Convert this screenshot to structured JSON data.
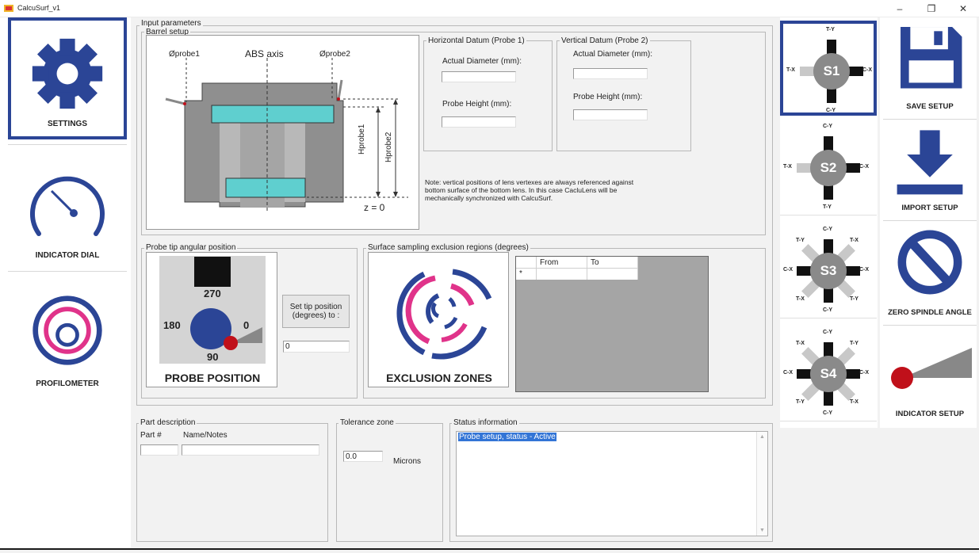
{
  "window": {
    "title": "CalcuSurf_v1",
    "minimize": "–",
    "maximize": "❐",
    "close": "✕"
  },
  "nav": {
    "settings": "SETTINGS",
    "indicator_dial": "INDICATOR DIAL",
    "profilometer": "PROFILOMETER"
  },
  "input_params": {
    "title": "Input parameters",
    "barrel_setup": {
      "title": "Barrel setup",
      "probe1_label": "Øprobe1",
      "probe2_label": "Øprobe2",
      "axis_label": "ABS axis",
      "h_probe1": "Hprobe1",
      "h_probe2": "Hprobe2",
      "z_label": "z = 0"
    },
    "horizontal_datum": {
      "title": "Horizontal Datum (Probe 1)",
      "diameter_label": "Actual Diameter (mm):",
      "diameter_value": "",
      "height_label": "Probe Height (mm):",
      "height_value": ""
    },
    "vertical_datum": {
      "title": "Vertical Datum (Probe 2)",
      "diameter_label": "Actual Diameter (mm):",
      "diameter_value": "",
      "height_label": "Probe Height (mm):",
      "height_value": ""
    },
    "note": "Note: vertical positions of lens vertexes are always referenced against bottom surface of the bottom lens. In this case CacluLens will be mechanically synchronized with CalcuSurf."
  },
  "probe_tip": {
    "title": "Probe tip angular position",
    "angles": {
      "top": "270",
      "left": "180",
      "right": "0",
      "bottom": "90"
    },
    "image_caption": "PROBE POSITION",
    "set_button": "Set tip position (degrees) to :",
    "value": "0"
  },
  "exclusion": {
    "title": "Surface sampling exclusion regions (degrees)",
    "image_caption": "EXCLUSION ZONES",
    "table": {
      "columns": [
        "From",
        "To"
      ],
      "new_row_marker": "*"
    }
  },
  "part_description": {
    "title": "Part description",
    "part_label": "Part #",
    "name_label": "Name/Notes",
    "part_value": "",
    "name_value": ""
  },
  "tolerance": {
    "title": "Tolerance zone",
    "value": "0.0",
    "unit": "Microns"
  },
  "status": {
    "title": "Status information",
    "text": "Probe setup, status - Active"
  },
  "sensors": [
    {
      "id": "S1",
      "top": "T-Y",
      "left": "T-X",
      "right": "C-X",
      "bottom": "C-Y",
      "selected": true
    },
    {
      "id": "S2",
      "top": "C-Y",
      "left": "T-X",
      "right": "C-X",
      "bottom": "T-Y",
      "selected": false
    },
    {
      "id": "S3",
      "top": "C-Y",
      "left": "C-X",
      "right": "C-X",
      "bottom": "C-Y",
      "tl": "T-Y",
      "tr": "T-X",
      "bl": "T-X",
      "br": "T-Y",
      "selected": false
    },
    {
      "id": "S4",
      "top": "C-Y",
      "left": "C-X",
      "right": "C-X",
      "bottom": "C-Y",
      "tl": "T-X",
      "tr": "T-Y",
      "bl": "T-Y",
      "br": "T-X",
      "selected": false
    }
  ],
  "actions": {
    "save": "SAVE SETUP",
    "import": "IMPORT SETUP",
    "zero_spindle": "ZERO SPINDLE ANGLE",
    "indicator_setup": "INDICATOR SETUP"
  },
  "colors": {
    "accent": "#2b4596",
    "magenta": "#e0338a",
    "lens": "#5fcfcf",
    "probe_red": "#c0101a",
    "selection": "#3375d6"
  }
}
